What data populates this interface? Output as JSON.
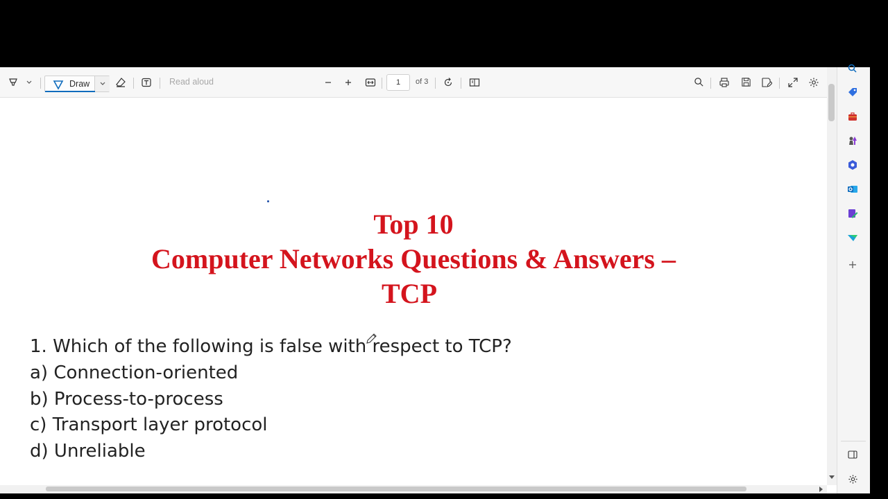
{
  "toolbar": {
    "draw_label": "Draw",
    "read_aloud_label": "Read aloud",
    "page_number": "1",
    "page_total": "of 3"
  },
  "document": {
    "title_line1": "Top 10",
    "title_line2": "Computer Networks Questions & Answers –",
    "title_line3": "TCP",
    "question": "1. Which of the following is false with respect to TCP?",
    "options": [
      "a) Connection-oriented",
      "b) Process-to-process",
      "c) Transport layer protocol",
      "d) Unreliable"
    ]
  },
  "colors": {
    "title": "#d4141d",
    "accent": "#0f6cbd"
  },
  "sidebar_icons": [
    "search-icon",
    "tag-icon",
    "briefcase-icon",
    "chess-icon",
    "copilot-icon",
    "outlook-icon",
    "tools-icon",
    "maps-icon",
    "add-icon",
    "panel-icon",
    "settings-icon"
  ]
}
